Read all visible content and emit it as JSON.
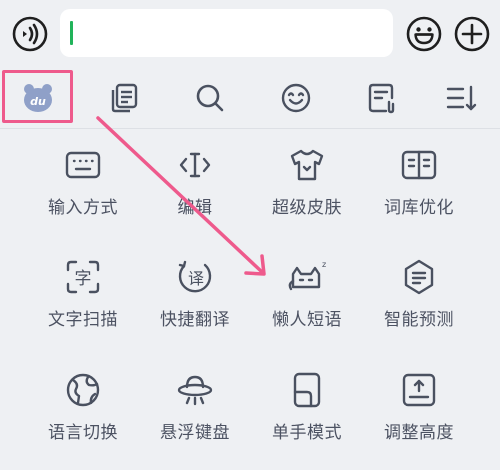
{
  "input": {
    "value": ""
  },
  "toolbar": {
    "items": [
      {
        "icon": "du-bear-logo-icon"
      },
      {
        "icon": "clipboard-icon"
      },
      {
        "icon": "search-icon"
      },
      {
        "icon": "emoji-icon"
      },
      {
        "icon": "note-edit-icon"
      },
      {
        "icon": "menu-collapse-icon"
      }
    ]
  },
  "grid": {
    "items": [
      {
        "label": "输入方式",
        "icon": "keyboard-icon"
      },
      {
        "label": "编辑",
        "icon": "text-cursor-icon"
      },
      {
        "label": "超级皮肤",
        "icon": "tshirt-icon"
      },
      {
        "label": "词库优化",
        "icon": "book-icon"
      },
      {
        "label": "文字扫描",
        "icon": "scan-text-icon"
      },
      {
        "label": "快捷翻译",
        "icon": "translate-icon"
      },
      {
        "label": "懒人短语",
        "icon": "sleeping-cat-icon"
      },
      {
        "label": "智能预测",
        "icon": "prediction-icon"
      },
      {
        "label": "语言切换",
        "icon": "globe-icon"
      },
      {
        "label": "悬浮键盘",
        "icon": "ufo-icon"
      },
      {
        "label": "单手模式",
        "icon": "one-hand-icon"
      },
      {
        "label": "调整高度",
        "icon": "adjust-height-icon"
      }
    ]
  },
  "colors": {
    "accent": "#ee5a8c",
    "caret": "#21b35a",
    "icon": "#4a5160",
    "logo": "#8fa0c8"
  }
}
